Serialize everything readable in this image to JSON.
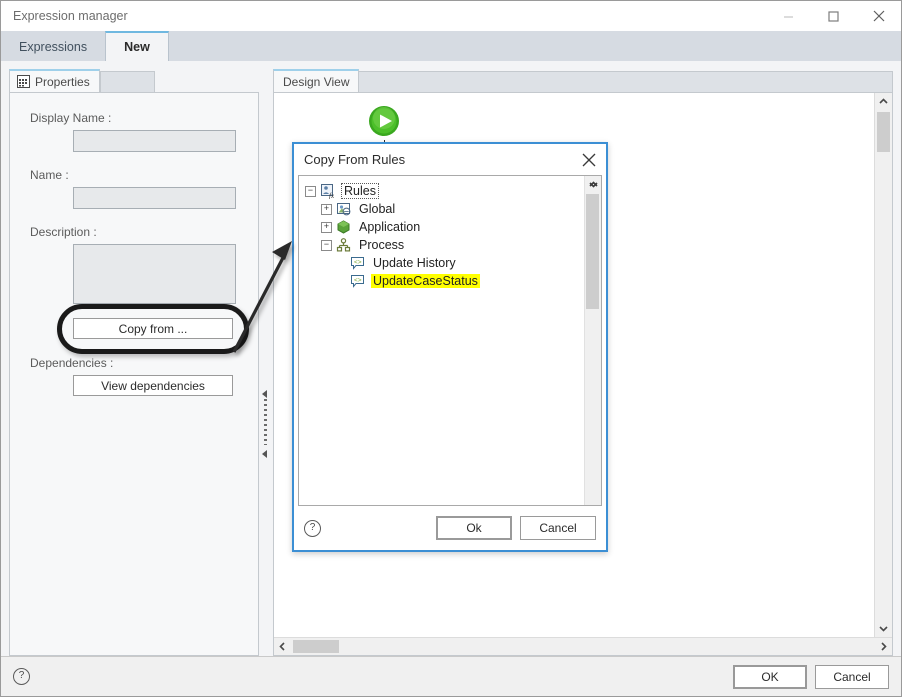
{
  "window": {
    "title": "Expression manager",
    "controls": {
      "minimize": "minimize-icon",
      "maximize": "maximize-icon",
      "close": "close-icon"
    }
  },
  "tabs": [
    {
      "label": "Expressions",
      "active": false
    },
    {
      "label": "New",
      "active": true
    }
  ],
  "properties_panel": {
    "tab_label": "Properties",
    "tab_icon": "properties-grid-icon",
    "fields": [
      {
        "label": "Display Name :",
        "value": "",
        "placeholder": "",
        "type": "text"
      },
      {
        "label": "Name :",
        "value": "",
        "placeholder": "",
        "type": "text"
      },
      {
        "label": "Description :",
        "value": "",
        "placeholder": "",
        "type": "textarea"
      }
    ],
    "copy_from_button": "Copy from ...",
    "dependencies_label": "Dependencies :",
    "view_dependencies_button": "View dependencies"
  },
  "design_view": {
    "tab_label": "Design View",
    "start_node_icon": "green-play-start-icon",
    "vertical_scrollbar": {
      "up": "chevron-up-icon",
      "down": "chevron-down-icon"
    },
    "horizontal_scrollbar": {
      "left": "chevron-left-icon",
      "right": "chevron-right-icon"
    }
  },
  "dialog": {
    "title": "Copy From Rules",
    "close_icon": "close-icon",
    "tree": [
      {
        "label": "Rules",
        "level": 0,
        "icon": "rules-fx-icon",
        "expander": "minus",
        "selected": false,
        "root": true
      },
      {
        "label": "Global",
        "level": 1,
        "icon": "global-image-icon",
        "expander": "plus",
        "selected": false,
        "root": false
      },
      {
        "label": "Application",
        "level": 1,
        "icon": "application-hexagon-icon",
        "expander": "plus",
        "selected": false,
        "root": false
      },
      {
        "label": "Process",
        "level": 1,
        "icon": "process-hierarchy-icon",
        "expander": "minus",
        "selected": false,
        "root": false
      },
      {
        "label": "Update History",
        "level": 2,
        "icon": "rule-bubble-icon",
        "expander": "none",
        "selected": false,
        "root": false
      },
      {
        "label": "UpdateCaseStatus",
        "level": 2,
        "icon": "rule-bubble-icon",
        "expander": "none",
        "selected": true,
        "root": false
      }
    ],
    "help_icon": "help-circle-icon",
    "ok_button": "Ok",
    "cancel_button": "Cancel",
    "scrollbar": {
      "up": "chevron-up-icon",
      "down": "chevron-down-icon"
    }
  },
  "footer": {
    "help_icon": "help-circle-icon",
    "ok_button": "OK",
    "cancel_button": "Cancel"
  },
  "annotations": {
    "highlight_target": "Copy from ...",
    "arrow": "callout-arrow",
    "highlight_ring_color": "#1a1a1a",
    "selection_highlight_color": "#ffff00"
  },
  "colors": {
    "tabstrip_bg": "#d6dbe2",
    "active_tab_accent": "#6fb8e0",
    "dialog_border": "#3c8fd4",
    "panel_bg": "#f7f8f9",
    "input_disabled_bg": "#e7e9eb"
  }
}
